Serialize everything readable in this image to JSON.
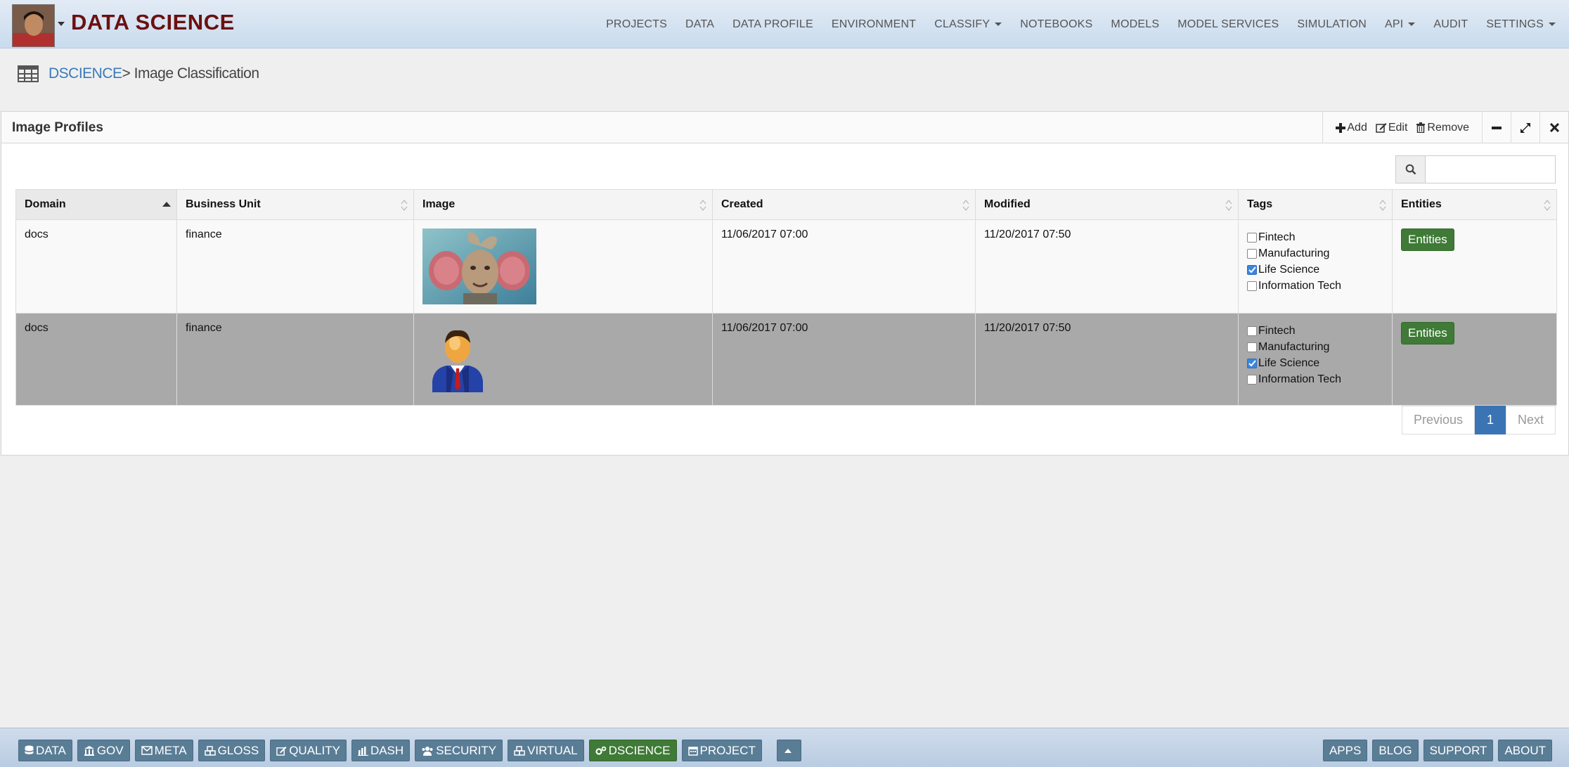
{
  "app": {
    "brand": "DATA SCIENCE"
  },
  "nav": {
    "items": [
      "PROJECTS",
      "DATA",
      "DATA PROFILE",
      "ENVIRONMENT",
      "CLASSIFY",
      "NOTEBOOKS",
      "MODELS",
      "MODEL SERVICES",
      "SIMULATION",
      "API",
      "AUDIT",
      "SETTINGS"
    ]
  },
  "breadcrumb": {
    "root": "DSCIENCE",
    "current": "> Image Classification"
  },
  "panel": {
    "title": "Image Profiles",
    "add_label": "Add",
    "edit_label": "Edit",
    "remove_label": "Remove"
  },
  "search": {
    "placeholder": "",
    "value": ""
  },
  "table": {
    "columns": [
      "Domain",
      "Business Unit",
      "Image",
      "Created",
      "Modified",
      "Tags",
      "Entities"
    ],
    "rows": [
      {
        "domain": "docs",
        "business_unit": "finance",
        "image": "elephant-man-photo",
        "created": "11/06/2017 07:00",
        "modified": "11/20/2017 07:50",
        "tags": [
          {
            "label": "Fintech",
            "checked": false
          },
          {
            "label": "Manufacturing",
            "checked": false
          },
          {
            "label": "Life Science",
            "checked": true
          },
          {
            "label": "Information Tech",
            "checked": false
          }
        ],
        "entities_label": "Entities"
      },
      {
        "domain": "docs",
        "business_unit": "finance",
        "image": "businessman-icon",
        "created": "11/06/2017 07:00",
        "modified": "11/20/2017 07:50",
        "tags": [
          {
            "label": "Fintech",
            "checked": false
          },
          {
            "label": "Manufacturing",
            "checked": false
          },
          {
            "label": "Life Science",
            "checked": true
          },
          {
            "label": "Information Tech",
            "checked": false
          }
        ],
        "entities_label": "Entities"
      }
    ]
  },
  "pagination": {
    "previous": "Previous",
    "current": "1",
    "next": "Next"
  },
  "bottombar": {
    "left": [
      "DATA",
      "GOV",
      "META",
      "GLOSS",
      "QUALITY",
      "DASH",
      "SECURITY",
      "VIRTUAL",
      "DSCIENCE",
      "PROJECT"
    ],
    "right": [
      "APPS",
      "BLOG",
      "SUPPORT",
      "ABOUT"
    ],
    "active": "DSCIENCE"
  },
  "colors": {
    "brand": "#6b1010",
    "link": "#3a7ab8",
    "success": "#3f7a37",
    "primary": "#3b74b4",
    "bottom_button": "#5a7d96"
  }
}
